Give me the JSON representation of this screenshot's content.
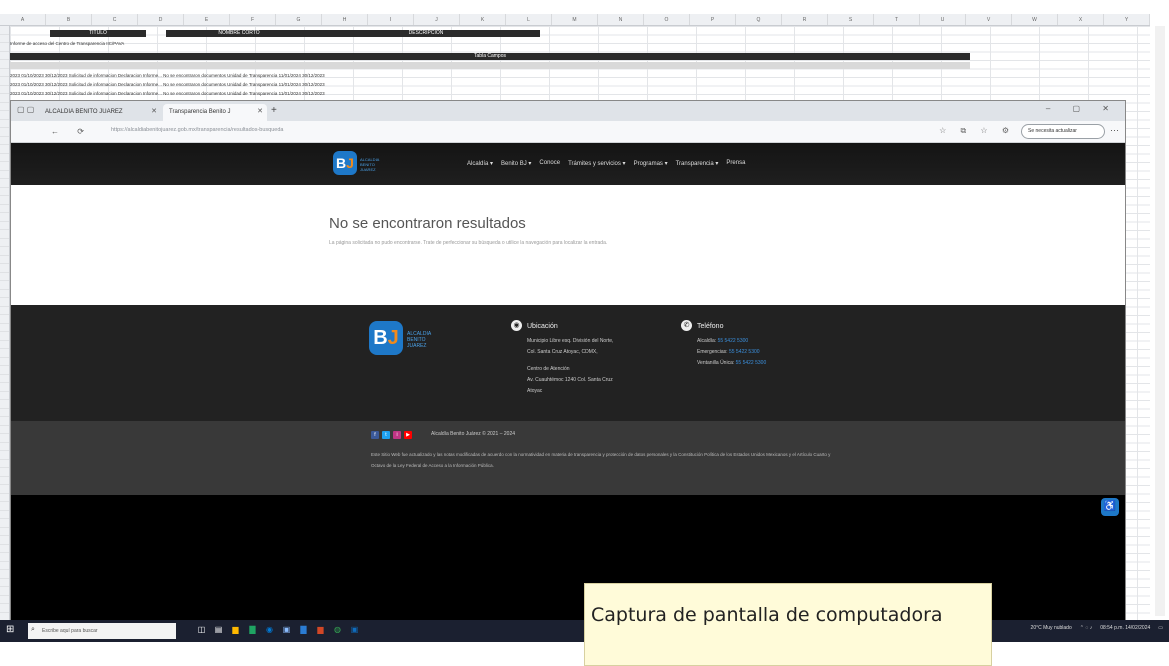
{
  "spreadsheet": {
    "columns": [
      "A",
      "B",
      "C",
      "D",
      "E",
      "F",
      "G",
      "H",
      "I",
      "J",
      "K",
      "L",
      "M",
      "N",
      "O",
      "P",
      "Q",
      "R",
      "S",
      "T",
      "U",
      "V",
      "W",
      "X",
      "Y"
    ],
    "header_top": {
      "titulo": "TITULO",
      "nombre_corto": "NOMBRE CORTO",
      "descripcion": "DESCRIPCION"
    },
    "header_row2": "Informe de acceso del Centro de Transparencia IIC/PAVA",
    "datos_label": "Tabla Campos",
    "rows": [
      "2023   01/10/2023   30/12/2023   Solicitud de informacion   Declaracion   Informe...   No se encontraron documentos   Unidad de Transparencia   11/01/2024   30/12/2023",
      "2023   01/10/2023   30/12/2023   Solicitud de informacion   Declaracion   Informe...   No se encontraron documentos   Unidad de Transparencia   11/01/2024   30/12/2023",
      "2023   01/10/2023   30/12/2023   Solicitud de informacion   Declaracion   Informe...   No se encontraron documentos   Unidad de Transparencia   11/01/2024   30/12/2023"
    ]
  },
  "browser": {
    "tabs": [
      {
        "label": "ALCALDIA BENITO JUAREZ"
      },
      {
        "label": "Transparencia Benito J"
      }
    ],
    "url": "https://alcaldiabenitojuarez.gob.mx/transparencia/resultados-busqueda",
    "profile": "Se necesita actualizar"
  },
  "site": {
    "logo_text": [
      "ALCALDIA",
      "BENITO",
      "JUAREZ"
    ],
    "menu": [
      "Alcaldía ▾",
      "Benito BJ ▾",
      "Conoce",
      "Trámites y servicios ▾",
      "Programas ▾",
      "Transparencia ▾",
      "Prensa"
    ],
    "no_results_title": "No se encontraron resultados",
    "no_results_text": "La página solicitada no pudo encontrarse. Trate de perfeccionar su búsqueda o utilice la navegación para localizar la entrada.",
    "ubicacion": {
      "title": "Ubicación",
      "lines": [
        "Municipio Libre esq. División del Norte,",
        "Col. Santa Cruz Atoyac, CDMX,",
        "",
        "Centro de Atención",
        "Av. Cuauhtémoc 1240 Col. Santa Cruz",
        "Atoyac"
      ]
    },
    "telefono": {
      "title": "Teléfono",
      "lines": [
        {
          "label": "Alcaldía:",
          "value": "55 5422 5300"
        },
        {
          "label": "Emergencias:",
          "value": "55 5422 5300"
        },
        {
          "label": "Ventanilla Única:",
          "value": "55 5422 5300"
        }
      ]
    },
    "copyright": "Alcaldía Benito Juárez © 2021 – 2024",
    "legal": "Este Sitio Web fue actualizado y las notas modificadas de acuerdo con la normatividad en materia de transparencia y protección de datos personales y la Constitución Política de los Estados Unidos Mexicanos y el Artículo Cuarto y Octavo de la Ley Federal de Acceso a la Información Pública."
  },
  "taskbar": {
    "search_placeholder": "Escribe aquí para buscar",
    "tray_weather": "20°C Muy nublado",
    "tray_time": "08:54 p.m.",
    "tray_date": "14/02/2024"
  },
  "caption": "Captura de pantalla de computadora",
  "colors": {
    "brand_blue": "#1e78c8",
    "brand_orange": "#f08a1c"
  }
}
